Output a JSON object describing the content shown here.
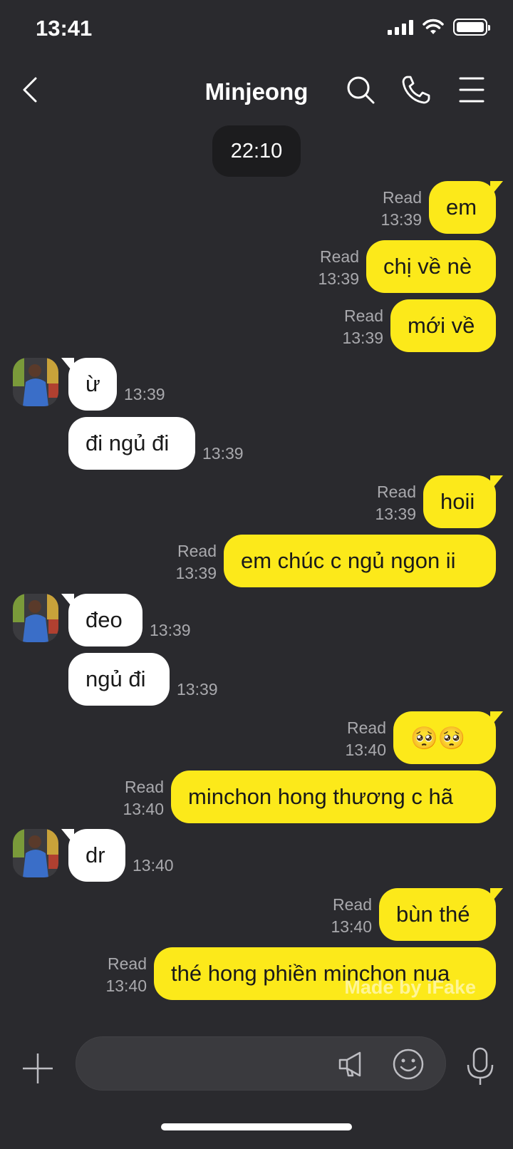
{
  "status": {
    "time": "13:41"
  },
  "header": {
    "title": "Minjeong"
  },
  "date_pill": "22:10",
  "messages": [
    {
      "dir": "out",
      "text": "em",
      "read": "Read",
      "time": "13:39"
    },
    {
      "dir": "out",
      "text": "chị về nè",
      "read": "Read",
      "time": "13:39"
    },
    {
      "dir": "out",
      "text": "mới về",
      "read": "Read",
      "time": "13:39"
    },
    {
      "dir": "in",
      "text": "ừ",
      "time": "13:39"
    },
    {
      "dir": "in",
      "text": "đi ngủ đi",
      "time": "13:39"
    },
    {
      "dir": "out",
      "text": "hoii",
      "read": "Read",
      "time": "13:39"
    },
    {
      "dir": "out",
      "text": "em chúc c ngủ ngon ii",
      "read": "Read",
      "time": "13:39"
    },
    {
      "dir": "in",
      "text": "đeo",
      "time": "13:39"
    },
    {
      "dir": "in",
      "text": "ngủ đi",
      "time": "13:39"
    },
    {
      "dir": "out",
      "text": "🥺🥺",
      "read": "Read",
      "time": "13:40"
    },
    {
      "dir": "out",
      "text": "minchon hong thương c hã",
      "read": "Read",
      "time": "13:40"
    },
    {
      "dir": "in",
      "text": "dr",
      "time": "13:40"
    },
    {
      "dir": "out",
      "text": "bùn thé",
      "read": "Read",
      "time": "13:40"
    },
    {
      "dir": "out",
      "text": "thé hong phiền minchon nua",
      "read": "Read",
      "time": "13:40"
    }
  ],
  "watermark": "Made by iFake",
  "input": {
    "placeholder": ""
  },
  "colors": {
    "background": "#2a2a2e",
    "outgoing_bubble": "#fce91a",
    "incoming_bubble": "#ffffff"
  }
}
